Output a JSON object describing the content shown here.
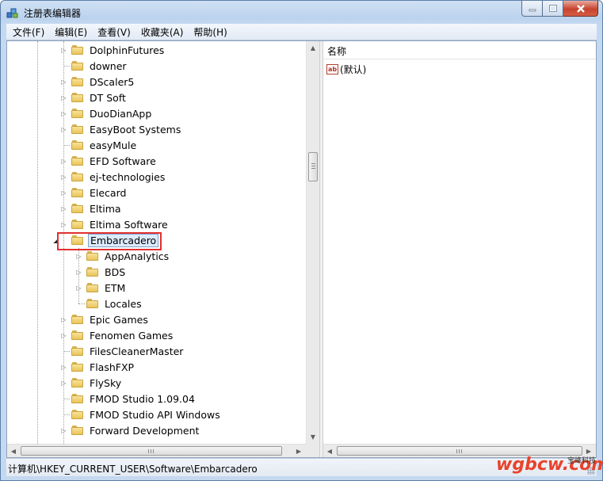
{
  "window": {
    "title": "注册表编辑器",
    "controls": {
      "minimize_icon": "minimize-icon",
      "maximize_icon": "maximize-icon",
      "close_icon": "close-icon"
    }
  },
  "menu": [
    {
      "id": "file",
      "label": "文件(F)"
    },
    {
      "id": "edit",
      "label": "编辑(E)"
    },
    {
      "id": "view",
      "label": "查看(V)"
    },
    {
      "id": "favorites",
      "label": "收藏夹(A)"
    },
    {
      "id": "help",
      "label": "帮助(H)"
    }
  ],
  "tree": {
    "nodes": [
      {
        "label": "DolphinFutures",
        "level": 1,
        "expander": "collapsed"
      },
      {
        "label": "downer",
        "level": 1,
        "expander": "none"
      },
      {
        "label": "DScaler5",
        "level": 1,
        "expander": "collapsed"
      },
      {
        "label": "DT Soft",
        "level": 1,
        "expander": "collapsed"
      },
      {
        "label": "DuoDianApp",
        "level": 1,
        "expander": "collapsed"
      },
      {
        "label": "EasyBoot Systems",
        "level": 1,
        "expander": "collapsed"
      },
      {
        "label": "easyMule",
        "level": 1,
        "expander": "none"
      },
      {
        "label": "EFD Software",
        "level": 1,
        "expander": "collapsed"
      },
      {
        "label": "ej-technologies",
        "level": 1,
        "expander": "collapsed"
      },
      {
        "label": "Elecard",
        "level": 1,
        "expander": "collapsed"
      },
      {
        "label": "Eltima",
        "level": 1,
        "expander": "collapsed"
      },
      {
        "label": "Eltima Software",
        "level": 1,
        "expander": "collapsed"
      },
      {
        "label": "Embarcadero",
        "level": 1,
        "expander": "expanded",
        "selected": true
      },
      {
        "label": "AppAnalytics",
        "level": 2,
        "expander": "collapsed"
      },
      {
        "label": "BDS",
        "level": 2,
        "expander": "collapsed"
      },
      {
        "label": "ETM",
        "level": 2,
        "expander": "collapsed"
      },
      {
        "label": "Locales",
        "level": 2,
        "expander": "none"
      },
      {
        "label": "Epic Games",
        "level": 1,
        "expander": "collapsed"
      },
      {
        "label": "Fenomen Games",
        "level": 1,
        "expander": "collapsed"
      },
      {
        "label": "FilesCleanerMaster",
        "level": 1,
        "expander": "none"
      },
      {
        "label": "FlashFXP",
        "level": 1,
        "expander": "collapsed"
      },
      {
        "label": "FlySky",
        "level": 1,
        "expander": "collapsed"
      },
      {
        "label": "FMOD Studio 1.09.04",
        "level": 1,
        "expander": "none"
      },
      {
        "label": "FMOD Studio API Windows",
        "level": 1,
        "expander": "none"
      },
      {
        "label": "Forward Development",
        "level": 1,
        "expander": "collapsed"
      }
    ]
  },
  "list": {
    "column_name": "名称",
    "rows": [
      {
        "icon": "string-value-icon",
        "icon_text": "ab",
        "name": "(默认)"
      }
    ]
  },
  "status": {
    "path": "计算机\\HKEY_CURRENT_USER\\Software\\Embarcadero"
  },
  "watermark": {
    "text": "wgbcw.com",
    "small": "宝峰科技"
  },
  "colors": {
    "selection_bg": "#dcebfc",
    "selection_border": "#7da2ce",
    "highlight_box": "#e23030",
    "watermark": "#e8432c"
  }
}
